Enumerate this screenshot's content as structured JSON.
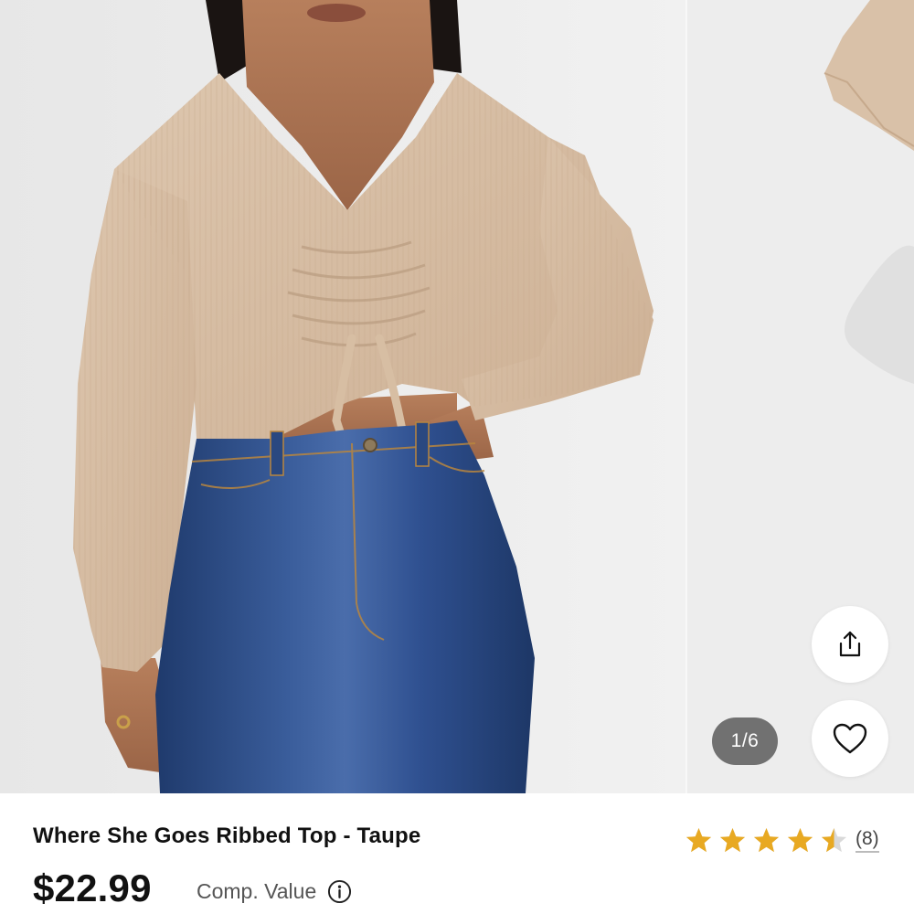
{
  "gallery": {
    "counter": "1/6",
    "share_icon": "share-icon",
    "favorite_icon": "heart-icon"
  },
  "product": {
    "title": "Where She Goes Ribbed Top - Taupe",
    "price": "$22.99",
    "comp_value_label": "Comp. Value",
    "rating": {
      "value": 4.5,
      "max": 5,
      "count_label": "(8)"
    }
  },
  "colors": {
    "star": "#E8A922",
    "star_empty": "#D9D9D9",
    "top_taupe": "#D8BFA6",
    "denim": "#2C4A82",
    "counter_bg": "#555555"
  }
}
